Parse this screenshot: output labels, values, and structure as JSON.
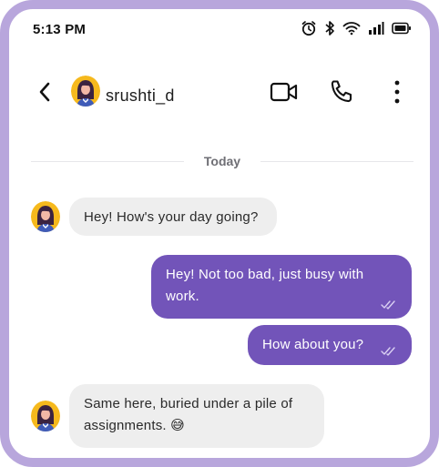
{
  "status_bar": {
    "time": "5:13 PM",
    "icons": [
      "alarm-icon",
      "bluetooth-icon",
      "wifi-icon",
      "signal-icon",
      "battery-icon"
    ]
  },
  "header": {
    "contact_name": "srushti_d",
    "icons": [
      "back-icon",
      "video-call-icon",
      "phone-icon",
      "more-icon"
    ]
  },
  "conversation": {
    "date_label": "Today",
    "messages": [
      {
        "direction": "incoming",
        "text": "Hey! How's your day going?"
      },
      {
        "direction": "outgoing",
        "line1": "Hey! Not too bad, just busy with",
        "line2": "work.",
        "status": "read"
      },
      {
        "direction": "outgoing",
        "text": "How about you?",
        "status": "read"
      },
      {
        "direction": "incoming",
        "line1": "Same here, buried under a pile of",
        "line2": "assignments. 😅"
      }
    ]
  },
  "colors": {
    "frame": "#b8a6dc",
    "outgoing_bubble": "#7254b9",
    "incoming_bubble": "#eeeeee",
    "avatar_bg": "#f6b91d"
  }
}
